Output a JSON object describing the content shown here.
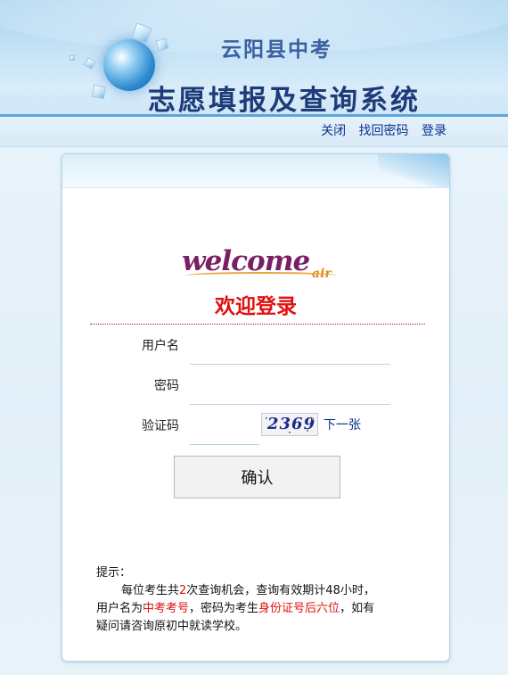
{
  "header": {
    "subtitle": "云阳县中考",
    "title": "志愿填报及查询系统"
  },
  "topnav": {
    "links": [
      "关闭",
      "找回密码",
      "登录"
    ]
  },
  "login": {
    "logo_text": "welcome",
    "logo_sub": "air",
    "heading": "欢迎登录",
    "username_label": "用户名",
    "username_value": "",
    "password_label": "密码",
    "password_value": "",
    "captcha_label": "验证码",
    "captcha_value": "",
    "captcha_text": "2369",
    "next_captcha": "下一张",
    "submit_label": "确认"
  },
  "tips": {
    "title": "提示：",
    "p1_a": "每位考生共",
    "p1_count": "2",
    "p1_b": "次查询机会，查询有效期计48小时，",
    "p2_a": "用户名为",
    "p2_user": "中考考号",
    "p2_b": "，密码为考生",
    "p2_pass": "身份证号后六位",
    "p2_c": "，如有",
    "p3": "疑问请咨询原初中就读学校。"
  },
  "colors": {
    "accent_red": "#e01010",
    "link_blue": "#0a2f8f",
    "header_blue": "#5aa6db"
  }
}
